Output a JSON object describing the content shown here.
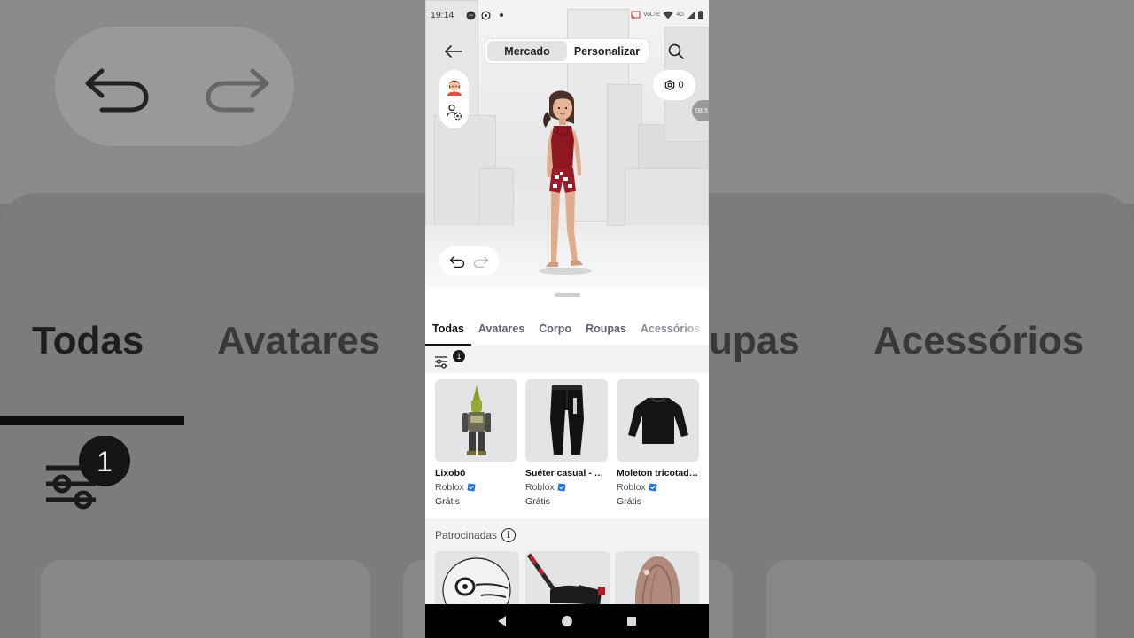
{
  "status_bar": {
    "time": "19:14",
    "app_icons": [
      "messenger-icon",
      "whatsapp-icon"
    ],
    "network_label": "VoLTE",
    "network_type": "4G"
  },
  "header": {
    "segments": [
      "Mercado",
      "Personalizar"
    ],
    "active_segment": "Mercado"
  },
  "robux": {
    "balance": "0"
  },
  "tabs": [
    "Todas",
    "Avatares",
    "Corpo",
    "Roupas",
    "Acessórios"
  ],
  "active_tab": "Todas",
  "filter": {
    "badge_count": "1"
  },
  "items": [
    {
      "name": "Lixobô",
      "creator": "Roblox",
      "price": "Grátis"
    },
    {
      "name": "Suéter casual - P…",
      "creator": "Roblox",
      "price": "Grátis"
    },
    {
      "name": "Moleton tricotad…",
      "creator": "Roblox",
      "price": "Grátis"
    }
  ],
  "overlay": {
    "time_chip": "08:3"
  },
  "sponsored": {
    "title": "Patrocinadas"
  },
  "colors": {
    "verified": "#1d6ff2",
    "accent": "#111111",
    "panel_bg": "#f3f3f3"
  }
}
